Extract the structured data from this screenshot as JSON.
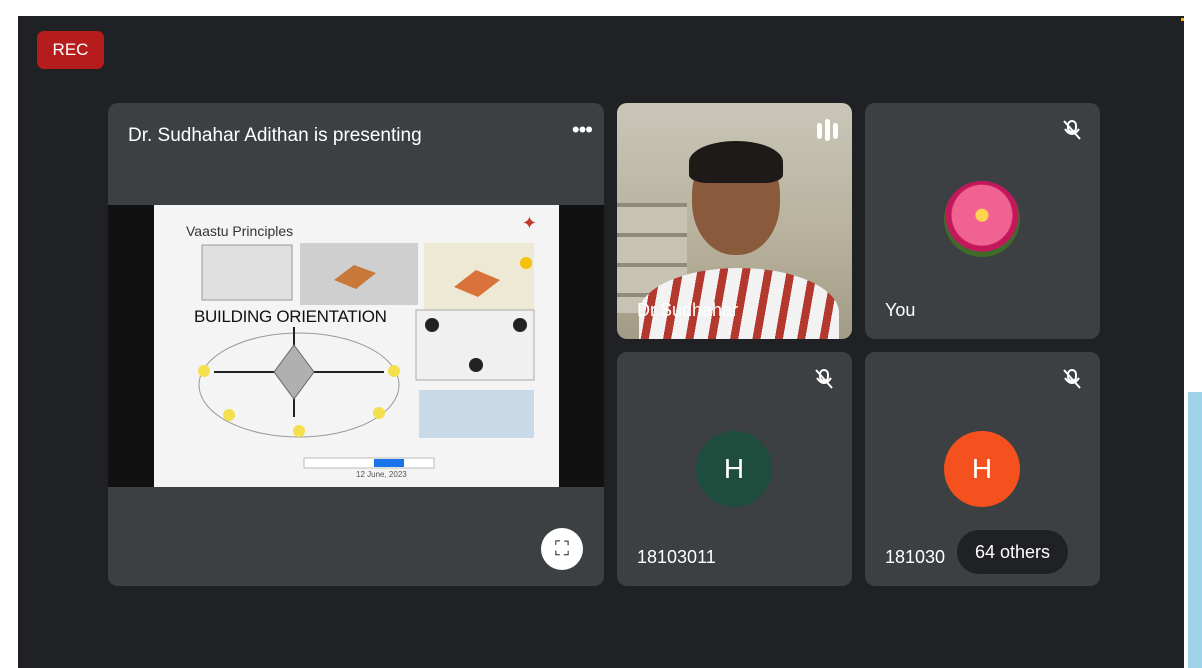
{
  "badge": {
    "rec": "REC"
  },
  "presentation": {
    "title": "Dr. Sudhahar Adithan is presenting",
    "more_icon": "more-horiz-icon",
    "fullscreen_icon": "fullscreen-icon",
    "slide": {
      "title": "Vaastu Principles",
      "heading": "BUILDING ORIENTATION",
      "date": "12 June, 2023"
    }
  },
  "tiles": [
    {
      "name": "Dr.Sudhahar",
      "icon": "audio-level-icon"
    },
    {
      "name": "You",
      "icon": "mic-off-icon"
    },
    {
      "name": "18103011",
      "initial": "H",
      "avatar_color": "#1e4d3d",
      "icon": "mic-off-icon"
    },
    {
      "name": "181030",
      "initial": "H",
      "avatar_color": "#f4511e",
      "icon": "mic-off-icon"
    }
  ],
  "overflow": {
    "label": "64 others"
  },
  "colors": {
    "background": "#202124",
    "tile": "#3c4043",
    "rec": "#b71c1c"
  }
}
